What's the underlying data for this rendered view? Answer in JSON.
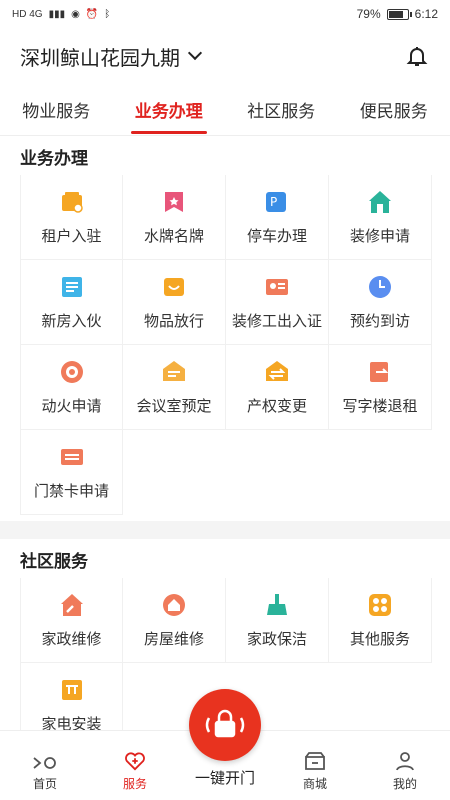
{
  "statusbar": {
    "network": "HD 4G",
    "battery_percent": "79%",
    "time": "6:12",
    "battery_level": 0.79
  },
  "header": {
    "community": "深圳鲸山花园九期"
  },
  "tabs": [
    {
      "label": "物业服务"
    },
    {
      "label": "业务办理"
    },
    {
      "label": "社区服务"
    },
    {
      "label": "便民服务"
    }
  ],
  "business": {
    "title": "业务办理",
    "items": [
      {
        "label": "租户入驻",
        "icon": "tenant-icon",
        "color": "#f5a623"
      },
      {
        "label": "水牌名牌",
        "icon": "nameplate-icon",
        "color": "#e8557a"
      },
      {
        "label": "停车办理",
        "icon": "parking-icon",
        "color": "#3a8ee6"
      },
      {
        "label": "装修申请",
        "icon": "renovation-icon",
        "color": "#2ab39a"
      },
      {
        "label": "新房入伙",
        "icon": "new-home-icon",
        "color": "#3fb4e8"
      },
      {
        "label": "物品放行",
        "icon": "goods-release-icon",
        "color": "#f5a623"
      },
      {
        "label": "装修工出入证",
        "icon": "worker-pass-icon",
        "color": "#f07a5a"
      },
      {
        "label": "预约到访",
        "icon": "appointment-icon",
        "color": "#5a8ef0"
      },
      {
        "label": "动火申请",
        "icon": "fire-permit-icon",
        "color": "#f07a5a"
      },
      {
        "label": "会议室预定",
        "icon": "meeting-room-icon",
        "color": "#f5b041"
      },
      {
        "label": "产权变更",
        "icon": "property-change-icon",
        "color": "#f5a623"
      },
      {
        "label": "写字楼退租",
        "icon": "office-checkout-icon",
        "color": "#f07a5a"
      },
      {
        "label": "门禁卡申请",
        "icon": "access-card-icon",
        "color": "#f07a5a"
      }
    ]
  },
  "community": {
    "title": "社区服务",
    "items": [
      {
        "label": "家政维修",
        "icon": "home-repair-icon",
        "color": "#f07a5a"
      },
      {
        "label": "房屋维修",
        "icon": "house-repair-icon",
        "color": "#f07a5a"
      },
      {
        "label": "家政保洁",
        "icon": "cleaning-icon",
        "color": "#2ab39a"
      },
      {
        "label": "其他服务",
        "icon": "other-services-icon",
        "color": "#f5a623"
      },
      {
        "label": "家电安装",
        "icon": "appliance-install-icon",
        "color": "#f5a623"
      }
    ]
  },
  "bottomnav": {
    "home": "首页",
    "service": "服务",
    "unlock": "一键开门",
    "mall": "商城",
    "mine": "我的"
  },
  "colors": {
    "accent": "#e0231f",
    "unlock": "#e8331f"
  }
}
